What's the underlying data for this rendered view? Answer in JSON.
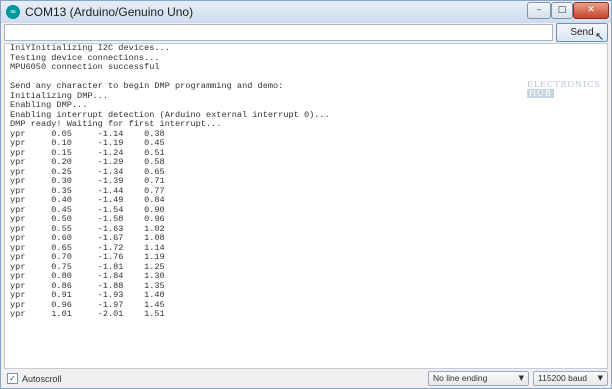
{
  "window": {
    "title": "COM13 (Arduino/Genuino Uno)",
    "app_icon_glyph": "∞",
    "min_glyph": "–",
    "max_glyph": "□",
    "close_glyph": "✕"
  },
  "toolbar": {
    "input_value": "",
    "send_label": "Send"
  },
  "output": {
    "lines": [
      "IniYInitializing I2C devices...",
      "Testing device connections...",
      "MPU6050 connection successful",
      "",
      "Send any character to begin DMP programming and demo:",
      "Initializing DMP...",
      "Enabling DMP...",
      "Enabling interrupt detection (Arduino external interrupt 0)...",
      "DMP ready! Waiting for first interrupt...",
      "ypr     0.05     -1.14    0.38",
      "ypr     0.10     -1.19    0.45",
      "ypr     0.15     -1.24    0.51",
      "ypr     0.20     -1.29    0.58",
      "ypr     0.25     -1.34    0.65",
      "ypr     0.30     -1.39    0.71",
      "ypr     0.35     -1.44    0.77",
      "ypr     0.40     -1.49    0.84",
      "ypr     0.45     -1.54    0.90",
      "ypr     0.50     -1.58    0.96",
      "ypr     0.55     -1.63    1.02",
      "ypr     0.60     -1.67    1.08",
      "ypr     0.65     -1.72    1.14",
      "ypr     0.70     -1.76    1.19",
      "ypr     0.75     -1.81    1.25",
      "ypr     0.80     -1.84    1.30",
      "ypr     0.86     -1.88    1.35",
      "ypr     0.91     -1.93    1.40",
      "ypr     0.96     -1.97    1.45",
      "ypr     1.01     -2.01    1.51"
    ],
    "watermark_text": "ELECTRONICS",
    "watermark_tag": "HUB"
  },
  "statusbar": {
    "autoscroll_label": "Autoscroll",
    "autoscroll_checked": true,
    "check_glyph": "✓",
    "line_ending": "No line ending",
    "baud_rate": "115200 baud",
    "chevron_glyph": "▼"
  }
}
